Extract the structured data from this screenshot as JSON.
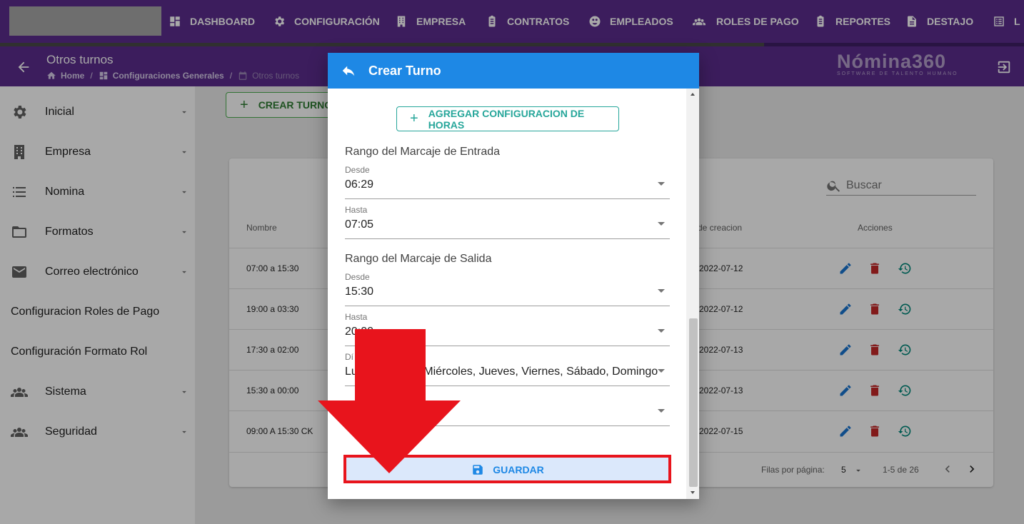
{
  "nav": {
    "items": [
      {
        "label": "DASHBOARD",
        "icon": "dashboard-icon"
      },
      {
        "label": "CONFIGURACIÓN",
        "icon": "gear-icon"
      },
      {
        "label": "EMPRESA",
        "icon": "building-icon"
      },
      {
        "label": "CONTRATOS",
        "icon": "clipboard-icon"
      },
      {
        "label": "EMPLEADOS",
        "icon": "employees-icon"
      },
      {
        "label": "ROLES DE PAGO",
        "icon": "people-icon"
      },
      {
        "label": "REPORTES",
        "icon": "clipboard-icon"
      },
      {
        "label": "DESTAJO",
        "icon": "document-icon"
      },
      {
        "label": "L",
        "icon": "list-icon"
      }
    ],
    "progress": 0.746
  },
  "header": {
    "title": "Otros turnos",
    "breadcrumb": [
      "Home",
      "Configuraciones Generales",
      "Otros turnos"
    ],
    "brand_name": "Nómina360",
    "brand_tagline": "SOFTWARE DE TALENTO HUMANO"
  },
  "sidebar": {
    "items": [
      {
        "label": "Inicial",
        "icon": "gear-icon",
        "expandable": true
      },
      {
        "label": "Empresa",
        "icon": "building-icon",
        "expandable": true
      },
      {
        "label": "Nomina",
        "icon": "list-icon",
        "expandable": true
      },
      {
        "label": "Formatos",
        "icon": "folder-icon",
        "expandable": true
      },
      {
        "label": "Correo electrónico",
        "icon": "mail-icon",
        "expandable": true
      },
      {
        "label": "Configuracion Roles de Pago",
        "icon": "",
        "expandable": false
      },
      {
        "label": "Configuración Formato Rol",
        "icon": "",
        "expandable": false
      },
      {
        "label": "Sistema",
        "icon": "people-icon",
        "expandable": true
      },
      {
        "label": "Seguridad",
        "icon": "people-icon",
        "expandable": true
      }
    ]
  },
  "main": {
    "crear_label": "CREAR TURNO",
    "search_placeholder": "Buscar",
    "columns": [
      "Nombre",
      "de creacion",
      "Acciones"
    ],
    "rows": [
      {
        "name": "07:00 a 15:30",
        "date": "2022-07-12"
      },
      {
        "name": "19:00 a 03:30",
        "date": "2022-07-12"
      },
      {
        "name": "17:30 a 02:00",
        "date": "2022-07-13"
      },
      {
        "name": "15:30 a 00:00",
        "date": "2022-07-13"
      },
      {
        "name": "09:00 A 15:30 CK",
        "date": "2022-07-15"
      }
    ],
    "rows_per_page_label": "Filas por página:",
    "rows_per_page": "5",
    "range": "1-5 de 26"
  },
  "dialog": {
    "title": "Crear Turno",
    "add_hours_label": "AGREGAR CONFIGURACION DE HORAS",
    "entrada_title": "Rango del Marcaje de Entrada",
    "salida_title": "Rango del Marcaje de Salida",
    "entrada_desde_label": "Desde",
    "entrada_desde_value": "06:29",
    "entrada_hasta_label": "Hasta",
    "entrada_hasta_value": "07:05",
    "salida_desde_label": "Desde",
    "salida_desde_value": "15:30",
    "salida_hasta_label": "Hasta",
    "salida_hasta_value": "20:00",
    "dias_label": "Dí",
    "dias_value": "Lunes, Martes, Miércoles, Jueves, Viernes, Sábado, Domingo",
    "extra_value": "",
    "guardar_label": "GUARDAR"
  },
  "colors": {
    "nav_bg": "#5b2d8e",
    "dialog_header": "#1e88e5",
    "outline_green": "#4caf50",
    "outline_teal": "#26a69a",
    "edit_blue": "#1976d2",
    "delete_red": "#c62828",
    "history_teal": "#00897b",
    "annotation_red": "#e8141c"
  }
}
